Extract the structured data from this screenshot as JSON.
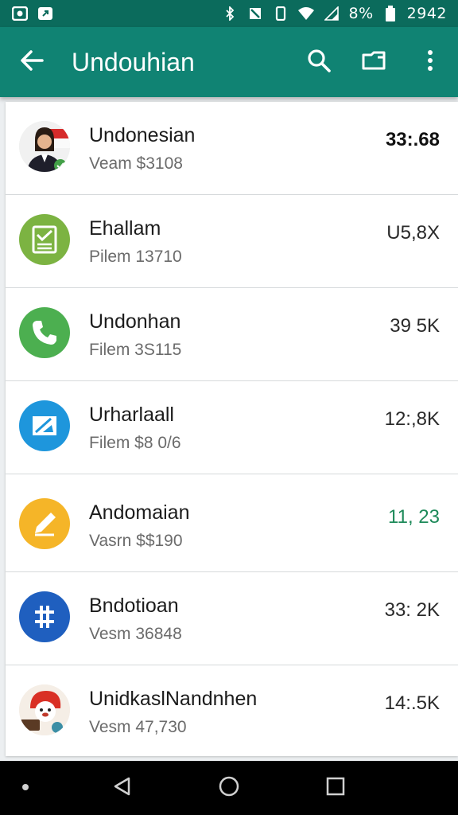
{
  "status_bar": {
    "battery_text": "8%",
    "time": "2942",
    "left_icons": [
      "gallery-icon",
      "message-icon"
    ],
    "right_icons": [
      "bluetooth-icon",
      "no-sim-icon",
      "vibrate-icon",
      "wifi-icon",
      "signal-icon",
      "battery-icon"
    ]
  },
  "app_bar": {
    "title": "Undouhian",
    "back_icon": "arrow-back-icon",
    "actions": [
      "search-icon",
      "folder-icon",
      "more-vert-icon"
    ]
  },
  "items": [
    {
      "title": "Undonesian",
      "subtitle": "Veam $3108",
      "size": "33:.68",
      "icon": "person-avatar-icon",
      "icon_bg": "#2e7d5b",
      "size_color": "#111111"
    },
    {
      "title": "Ehallam",
      "subtitle": "Pilem 13710",
      "size": "U5,8X",
      "icon": "clipboard-check-icon",
      "icon_bg": "#7cb342",
      "size_color": "#2a2a2a"
    },
    {
      "title": "Undonhan",
      "subtitle": "Filem 3S115",
      "size": "39 5K",
      "icon": "phone-icon",
      "icon_bg": "#4caf50",
      "size_color": "#2a2a2a"
    },
    {
      "title": "Urharlaall",
      "subtitle": "Filem $8 0/6",
      "size": "12:,8K",
      "icon": "image-edit-icon",
      "icon_bg": "#1e96dc",
      "size_color": "#2a2a2a"
    },
    {
      "title": "Andomaian",
      "subtitle": "Vasrn $$190",
      "size": "11, 23",
      "icon": "pencil-icon",
      "icon_bg": "#f5b528",
      "size_color": "#1e8a5a"
    },
    {
      "title": "Bndotioan",
      "subtitle": "Vesm 36848",
      "size": "33: 2K",
      "icon": "slider-icon",
      "icon_bg": "#1f5fbf",
      "size_color": "#2a2a2a"
    },
    {
      "title": "UnidkaslNandnhen",
      "subtitle": "Vesm 47,730",
      "size": "14:.5K",
      "icon": "mascot-icon",
      "icon_bg": "#f4ece4",
      "size_color": "#2a2a2a"
    }
  ],
  "nav_bar": {
    "buttons": [
      "dot-icon",
      "back-triangle-icon",
      "home-circle-icon",
      "recents-square-icon"
    ]
  }
}
